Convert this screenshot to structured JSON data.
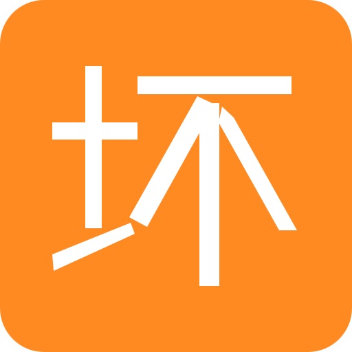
{
  "app_icon": {
    "glyph": "坏",
    "icon_name": "bad-character-icon",
    "background_color": "#FF8A22",
    "glyph_color": "#FFFFFF"
  }
}
